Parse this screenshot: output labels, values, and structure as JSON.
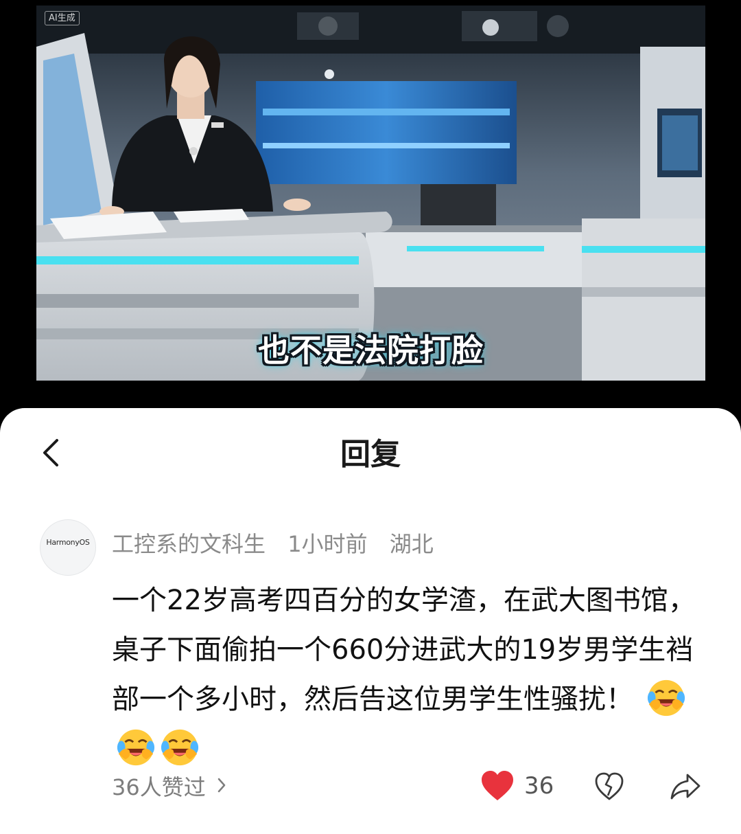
{
  "video": {
    "ai_badge": "AI生成",
    "subtitle": "也不是法院打脸"
  },
  "reply_sheet": {
    "title": "回复",
    "back_icon": "chevron-left-icon",
    "comment": {
      "avatar_text": "HarmonyOS",
      "username": "工控系的文科生",
      "time": "1小时前",
      "location": "湖北",
      "text": "一个22岁高考四百分的女学渣，在武大图书馆，桌子下面偷拍一个660分进武大的19岁男学生裆部一个多小时，然后告这位男学生性骚扰！",
      "emojis": [
        "laughing-crying-emoji",
        "laughing-crying-emoji",
        "laughing-crying-emoji"
      ],
      "likes_text": "36人赞过",
      "like_count": "36",
      "like_icon": "heart-icon",
      "dislike_icon": "broken-heart-icon",
      "share_icon": "share-icon",
      "colors": {
        "like": "#e8333d",
        "meta": "#8a8a8a",
        "text": "#111111"
      }
    }
  }
}
